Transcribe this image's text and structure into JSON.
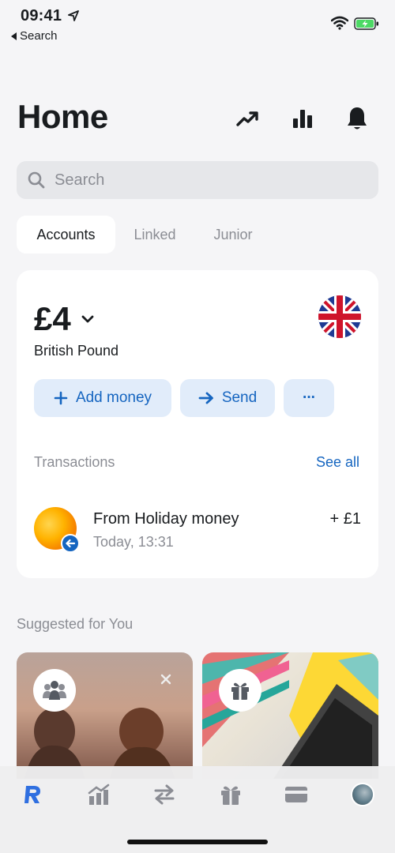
{
  "status_bar": {
    "time": "09:41",
    "back_label": "Search"
  },
  "header": {
    "title": "Home"
  },
  "search": {
    "placeholder": "Search"
  },
  "segments": [
    {
      "label": "Accounts",
      "active": true
    },
    {
      "label": "Linked",
      "active": false
    },
    {
      "label": "Junior",
      "active": false
    }
  ],
  "account": {
    "balance": "£4",
    "currency_name": "British Pound",
    "actions": {
      "add_money": "Add money",
      "send": "Send",
      "more": "···"
    }
  },
  "transactions": {
    "label": "Transactions",
    "see_all": "See all",
    "items": [
      {
        "title": "From Holiday money",
        "time": "Today, 13:31",
        "amount": "+ £1"
      }
    ]
  },
  "suggested": {
    "label": "Suggested for You"
  },
  "colors": {
    "accent": "#1565c0",
    "action_bg": "#e1ecfa",
    "background": "#f5f5f7",
    "battery": "#4cd964"
  },
  "icons": [
    "trending-up-icon",
    "bar-chart-icon",
    "bell-icon",
    "search-icon",
    "chevron-down-icon",
    "uk-flag-icon",
    "plus-icon",
    "arrow-right-icon",
    "close-icon",
    "gift-icon",
    "group-icon",
    "revolut-r-icon",
    "transfer-icon",
    "card-icon"
  ]
}
